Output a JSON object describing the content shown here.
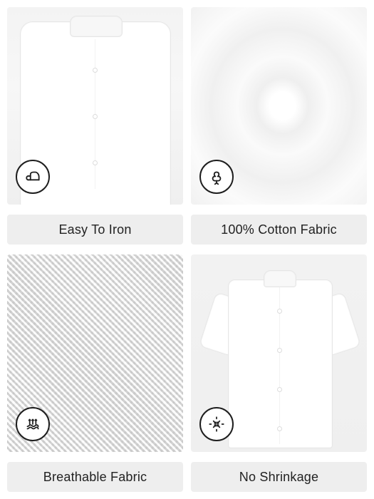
{
  "tiles": [
    {
      "label": "Easy To Iron",
      "icon": "iron-icon"
    },
    {
      "label": "100% Cotton Fabric",
      "icon": "cotton-icon"
    },
    {
      "label": "Breathable Fabric",
      "icon": "breathable-icon"
    },
    {
      "label": "No Shrinkage",
      "icon": "shrink-icon"
    }
  ],
  "colors": {
    "label_background": "#eeeeee",
    "label_text": "#222222",
    "icon_stroke": "#1e1e1e"
  }
}
